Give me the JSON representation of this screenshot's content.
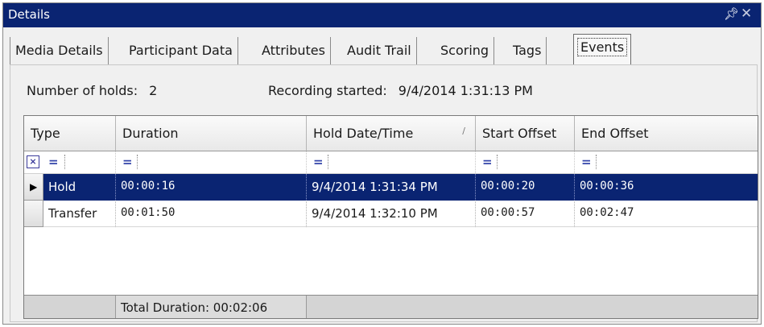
{
  "window": {
    "title": "Details",
    "pin_icon": "pin-icon",
    "close_icon": "close-icon",
    "accent_color": "#0a2472"
  },
  "tabs": [
    {
      "label": "Media Details",
      "active": false
    },
    {
      "label": "Participant Data",
      "active": false
    },
    {
      "label": "Attributes",
      "active": false
    },
    {
      "label": "Audit Trail",
      "active": false
    },
    {
      "label": "Scoring",
      "active": false
    },
    {
      "label": "Tags",
      "active": false
    },
    {
      "label": "Events",
      "active": true
    }
  ],
  "info": {
    "holds_label": "Number of holds:",
    "holds_value": "2",
    "recording_label": "Recording started:",
    "recording_value": "9/4/2014 1:31:13 PM"
  },
  "grid": {
    "columns": [
      "Type",
      "Duration",
      "Hold Date/Time",
      "Start Offset",
      "End Offset"
    ],
    "sorted_column": "Hold Date/Time",
    "filter_symbol": "=",
    "filter_icon": "filter-icon",
    "rows": [
      {
        "type": "Hold",
        "duration": "00:00:16",
        "hold_datetime": "9/4/2014 1:31:34 PM",
        "start_offset": "00:00:20",
        "end_offset": "00:00:36",
        "selected": true
      },
      {
        "type": "Transfer",
        "duration": "00:01:50",
        "hold_datetime": "9/4/2014 1:32:10 PM",
        "start_offset": "00:00:57",
        "end_offset": "00:02:47",
        "selected": false
      }
    ],
    "footer_total": "Total Duration: 00:02:06"
  }
}
